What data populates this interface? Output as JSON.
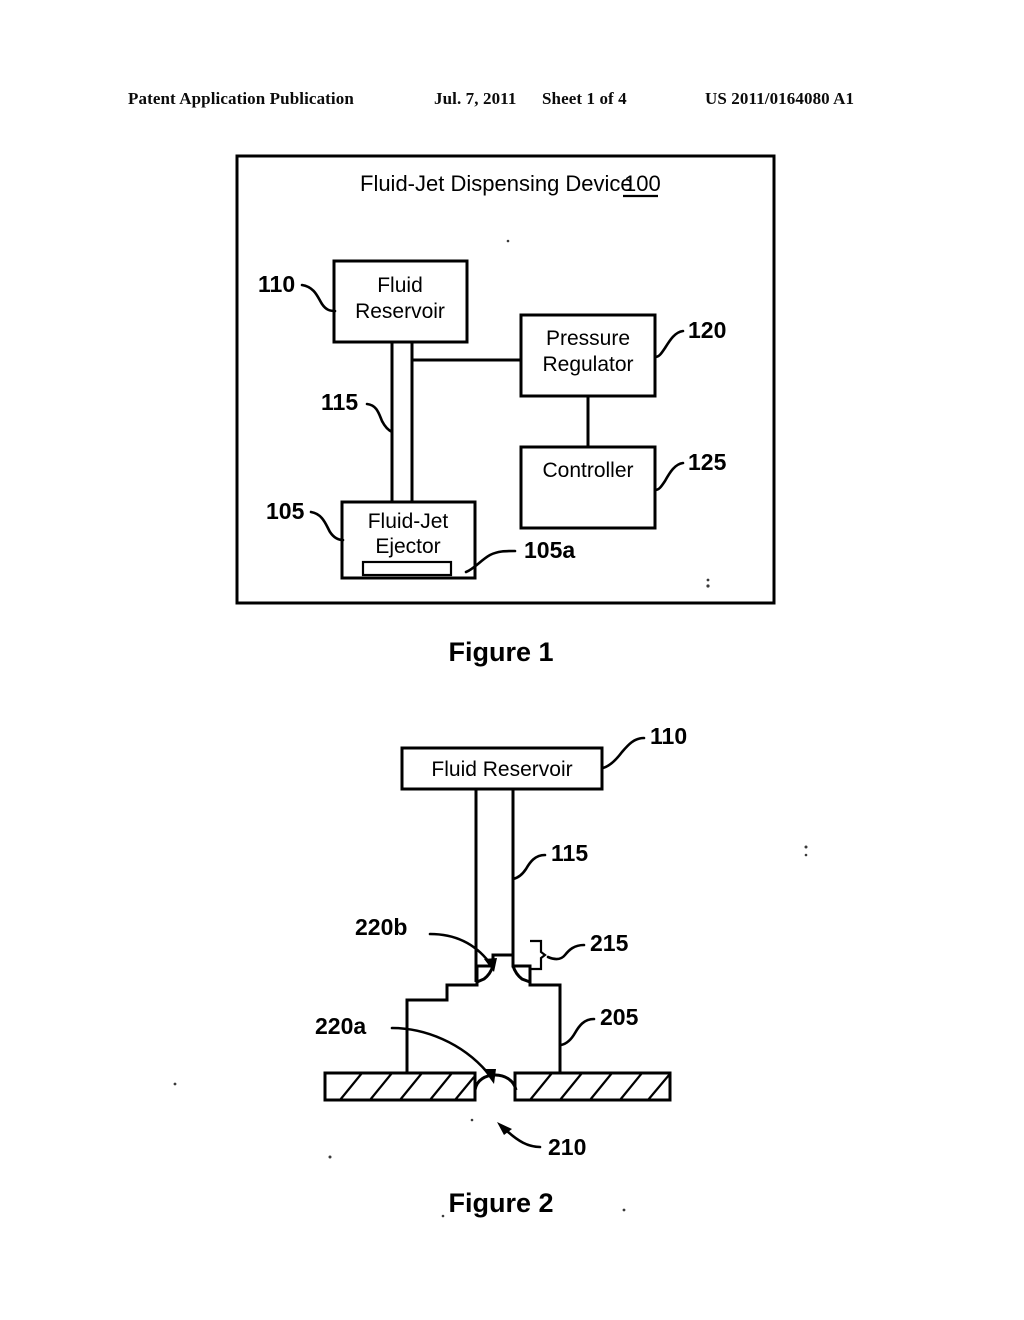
{
  "header": {
    "publication": "Patent Application Publication",
    "date": "Jul. 7, 2011",
    "sheet": "Sheet 1 of 4",
    "document_number": "US 2011/0164080 A1"
  },
  "figure1": {
    "caption": "Figure 1",
    "frame_title_text": "Fluid-Jet Dispensing Device",
    "frame_title_ref": "100",
    "boxes": [
      {
        "id": "fluid-reservoir",
        "line1": "Fluid",
        "line2": "Reservoir",
        "ref": "110"
      },
      {
        "id": "pressure-regulator",
        "line1": "Pressure",
        "line2": "Regulator",
        "ref": "120"
      },
      {
        "id": "controller",
        "line1": "Controller",
        "line2": "",
        "ref": "125"
      },
      {
        "id": "fluid-jet-ejector",
        "line1": "Fluid-Jet",
        "line2": "Ejector",
        "ref": "105"
      }
    ],
    "refs": {
      "conduit": "115",
      "ejector_orifice": "105a"
    }
  },
  "figure2": {
    "caption": "Figure 2",
    "boxes": [
      {
        "id": "fluid-reservoir",
        "label": "Fluid Reservoir",
        "ref": "110"
      }
    ],
    "refs": {
      "conduit": "115",
      "nozzle_body": "205",
      "droplet": "210",
      "orifice_bracket": "215",
      "flow_lower": "220a",
      "flow_upper": "220b"
    }
  },
  "colors": {
    "ink": "#000000",
    "paper": "#ffffff"
  }
}
